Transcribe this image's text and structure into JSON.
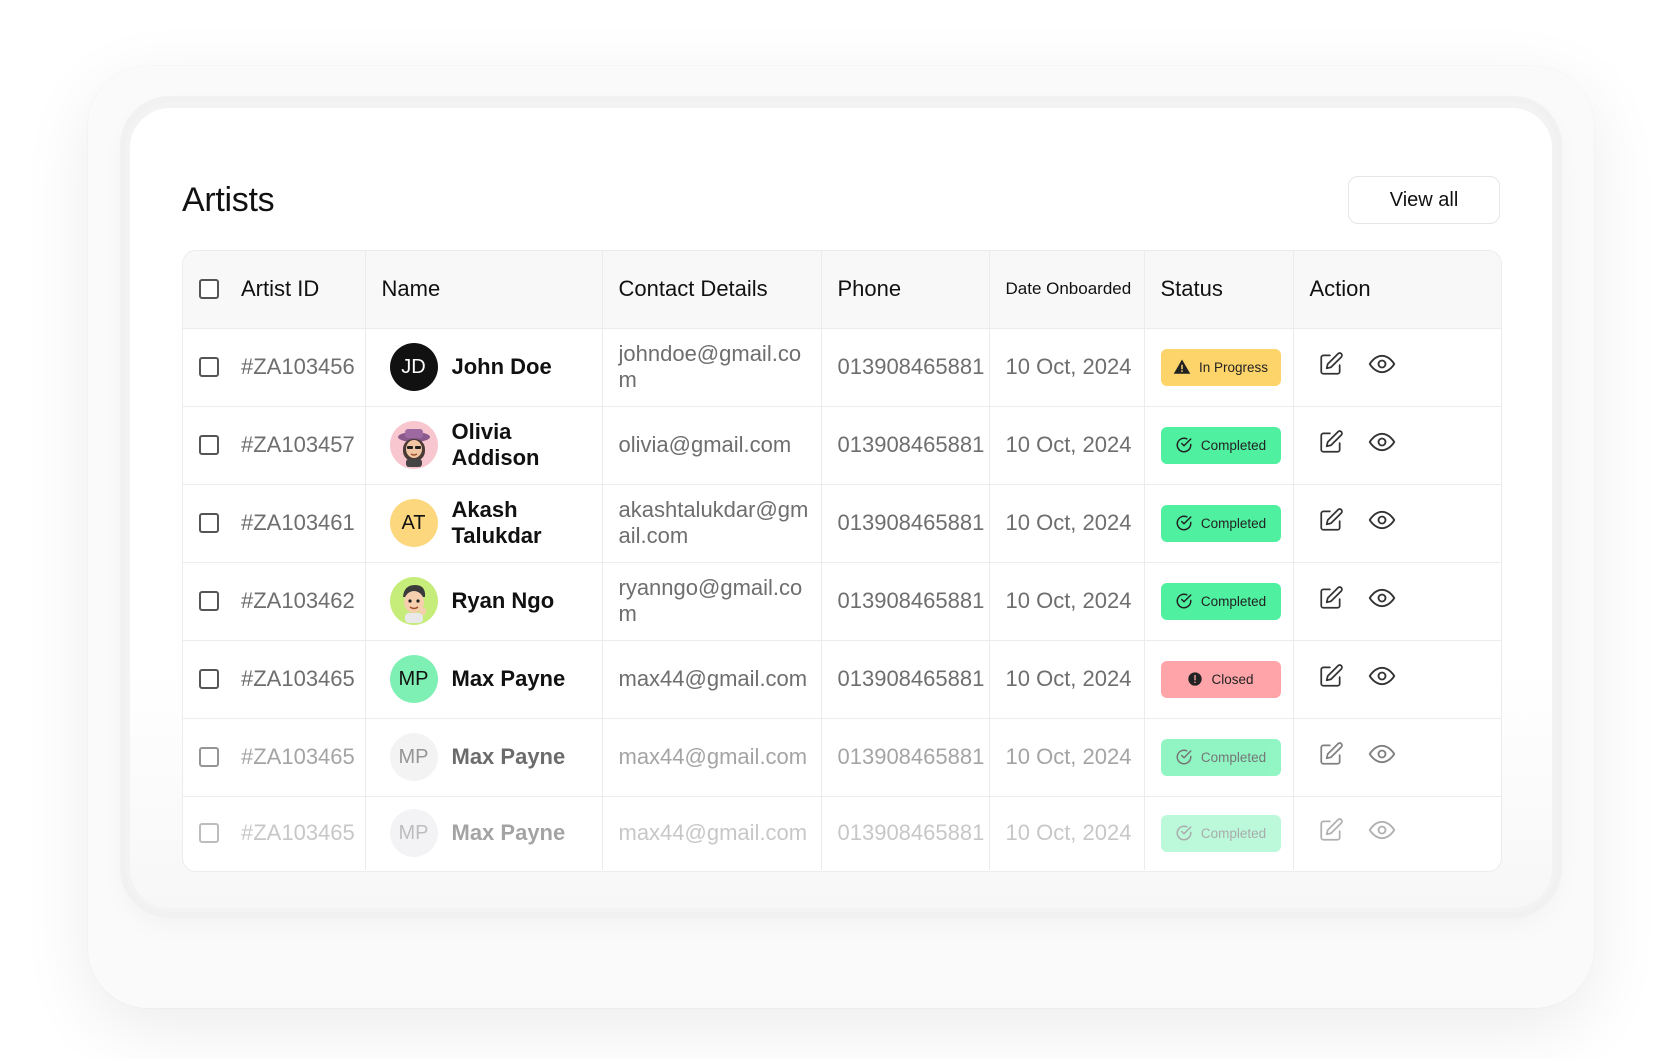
{
  "header": {
    "title": "Artists",
    "view_all_label": "View all"
  },
  "table": {
    "columns": [
      "Artist ID",
      "Name",
      "Contact Details",
      "Phone",
      "Date Onboarded",
      "Status",
      "Action"
    ],
    "rows": [
      {
        "id": "#ZA103456",
        "name": "John Doe",
        "email": "johndoe@gmail.com",
        "phone": "013908465881",
        "date": "10 Oct, 2024",
        "status": "In Progress",
        "status_kind": "progress",
        "avatar": {
          "kind": "initials",
          "text": "JD",
          "bg": "#111111",
          "fg": "#ffffff"
        }
      },
      {
        "id": "#ZA103457",
        "name": "Olivia Addison",
        "email": "olivia@gmail.com",
        "phone": "013908465881",
        "date": "10 Oct, 2024",
        "status": "Completed",
        "status_kind": "completed",
        "avatar": {
          "kind": "emoji",
          "icon": "woman-hat-avatar-icon",
          "bg": "#f7c6cf"
        }
      },
      {
        "id": "#ZA103461",
        "name": "Akash Talukdar",
        "email": "akashtalukdar@gmail.com",
        "phone": "013908465881",
        "date": "10 Oct, 2024",
        "status": "Completed",
        "status_kind": "completed",
        "avatar": {
          "kind": "initials",
          "text": "AT",
          "bg": "#fcd77d",
          "fg": "#111111"
        }
      },
      {
        "id": "#ZA103462",
        "name": "Ryan Ngo",
        "email": "ryanngo@gmail.com",
        "phone": "013908465881",
        "date": "10 Oct, 2024",
        "status": "Completed",
        "status_kind": "completed",
        "avatar": {
          "kind": "emoji",
          "icon": "man-avatar-icon",
          "bg": "#c6ec7a"
        }
      },
      {
        "id": "#ZA103465",
        "name": "Max Payne",
        "email": "max44@gmail.com",
        "phone": "013908465881",
        "date": "10 Oct, 2024",
        "status": "Closed",
        "status_kind": "closed",
        "avatar": {
          "kind": "initials",
          "text": "MP",
          "bg": "#7ff0b4",
          "fg": "#111111"
        }
      },
      {
        "id": "#ZA103465",
        "name": "Max Payne",
        "email": "max44@gmail.com",
        "phone": "013908465881",
        "date": "10 Oct, 2024",
        "status": "Completed",
        "status_kind": "completed",
        "avatar": {
          "kind": "initials",
          "text": "MP",
          "bg": "#ececec",
          "fg": "#555555"
        }
      },
      {
        "id": "#ZA103465",
        "name": "Max Payne",
        "email": "max44@gmail.com",
        "phone": "013908465881",
        "date": "10 Oct, 2024",
        "status": "Completed",
        "status_kind": "completed",
        "avatar": {
          "kind": "initials",
          "text": "MP",
          "bg": "#e0e2ea",
          "fg": "#555555"
        }
      }
    ]
  },
  "colors": {
    "progress_bg": "#fdd46a",
    "completed_bg": "#4ff0a0",
    "closed_bg": "#ffa5a9"
  },
  "icons": {
    "edit": "edit-icon",
    "view": "eye-icon",
    "progress": "warning-triangle-icon",
    "completed": "check-circle-icon",
    "closed": "alert-circle-icon"
  }
}
